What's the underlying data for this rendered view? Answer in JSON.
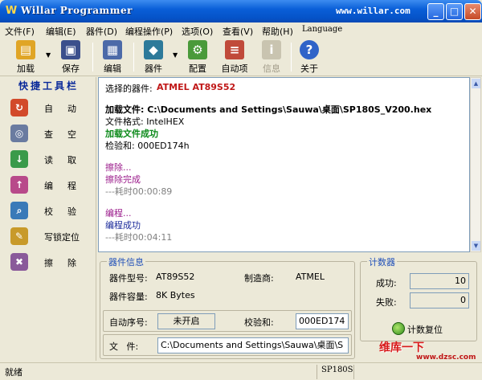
{
  "window": {
    "title": "Willar Programmer",
    "url": "www.willar.com"
  },
  "menu": [
    "文件(F)",
    "编辑(E)",
    "器件(D)",
    "编程操作(P)",
    "选项(O)",
    "查看(V)",
    "帮助(H)",
    "Language"
  ],
  "toolbar": {
    "load": "加载",
    "save": "保存",
    "edit": "编辑",
    "device": "器件",
    "config": "配置",
    "auto": "自动项",
    "info": "信息",
    "about": "关于"
  },
  "sidebar": {
    "header": "快捷工具栏",
    "items": [
      "自动",
      "查空",
      "读取",
      "编程",
      "校验",
      "写锁定位",
      "擦除"
    ]
  },
  "log": {
    "selected_label": "选择的器件:",
    "selected_value": "ATMEL  AT89S52",
    "load_file": "加载文件: C:\\Documents and Settings\\Sauwa\\桌面\\SP180S_V200.hex",
    "file_format": "文件格式: IntelHEX",
    "load_success": "加载文件成功",
    "checksum": "检验和:  000ED174h",
    "erasing": "擦除...",
    "erase_done": "擦除完成",
    "erase_time": "---耗时00:00:89",
    "programming": "编程...",
    "program_done": "编程成功",
    "program_time": "---耗时00:04:11"
  },
  "device_info": {
    "title": "器件信息",
    "model_label": "器件型号:",
    "model_value": "AT89S52",
    "maker_label": "制造商:",
    "maker_value": "ATMEL",
    "capacity_label": "器件容量:",
    "capacity_value": "8K Bytes",
    "auto_serial_label": "自动序号:",
    "auto_serial_value": "未开启",
    "checksum_label": "校验和:",
    "checksum_value": "000ED174",
    "file_label": "文   件:",
    "file_value": "C:\\Documents and Settings\\Sauwa\\桌面\\S"
  },
  "counter": {
    "title": "计数器",
    "success_label": "成功:",
    "success_value": "10",
    "fail_label": "失败:",
    "fail_value": "0",
    "reset": "计数复位"
  },
  "status": {
    "ready": "就绪",
    "model": "SP180S"
  },
  "watermark": {
    "brand": "维库一下",
    "url": "www.dzsc.com"
  }
}
